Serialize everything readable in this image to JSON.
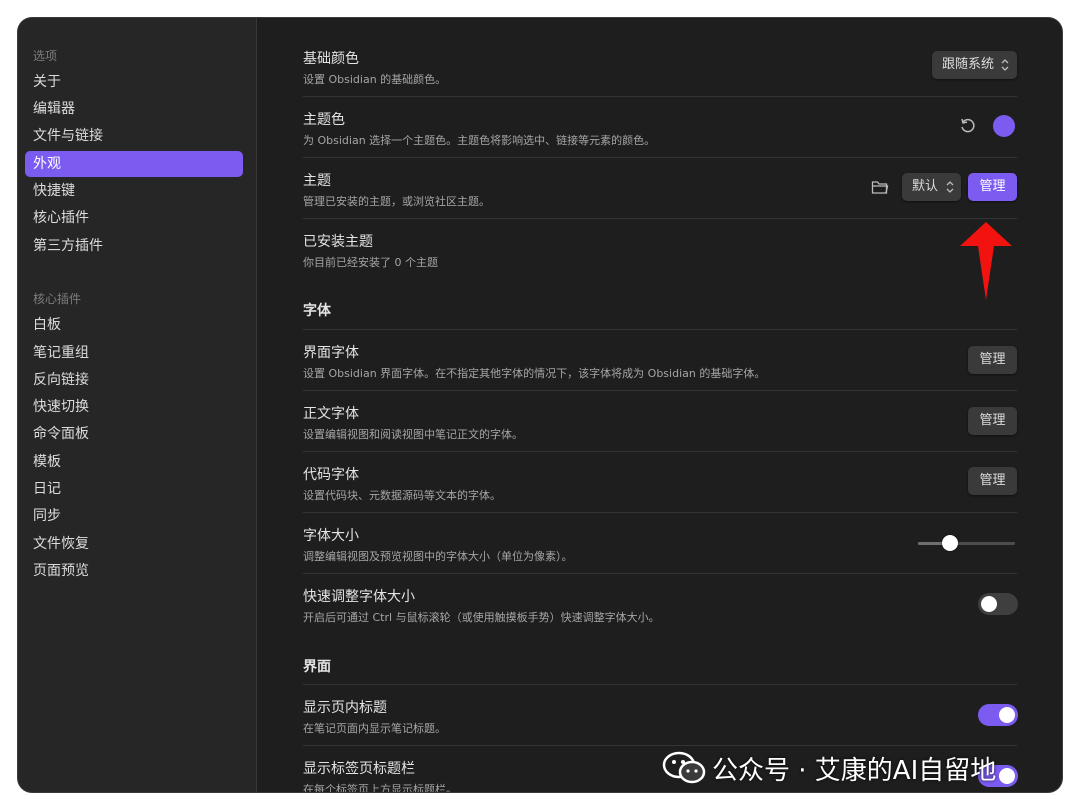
{
  "colors": {
    "accent": "#7b5bf0",
    "background": "#1e1e1e",
    "sidebar": "#262626"
  },
  "sidebar": {
    "sections": [
      {
        "title": "选项",
        "items": [
          "关于",
          "编辑器",
          "文件与链接",
          "外观",
          "快捷键",
          "核心插件",
          "第三方插件"
        ],
        "active_index": 3
      },
      {
        "title": "核心插件",
        "items": [
          "白板",
          "笔记重组",
          "反向链接",
          "快速切换",
          "命令面板",
          "模板",
          "日记",
          "同步",
          "文件恢复",
          "页面预览"
        ]
      }
    ]
  },
  "settings": {
    "base_color": {
      "title": "基础颜色",
      "desc": "设置 Obsidian 的基础颜色。",
      "value": "跟随系统"
    },
    "accent_color": {
      "title": "主题色",
      "desc": "为 Obsidian 选择一个主题色。主题色将影响选中、链接等元素的颜色。",
      "value": "#7b5bf0"
    },
    "theme": {
      "title": "主题",
      "desc": "管理已安装的主题，或浏览社区主题。",
      "value": "默认",
      "manage_label": "管理"
    },
    "installed_themes": {
      "title": "已安装主题",
      "desc": "你目前已经安装了 0 个主题"
    },
    "font_heading": "字体",
    "interface_font": {
      "title": "界面字体",
      "desc": "设置 Obsidian 界面字体。在不指定其他字体的情况下，该字体将成为 Obsidian 的基础字体。",
      "button": "管理"
    },
    "text_font": {
      "title": "正文字体",
      "desc": "设置编辑视图和阅读视图中笔记正文的字体。",
      "button": "管理"
    },
    "code_font": {
      "title": "代码字体",
      "desc": "设置代码块、元数据源码等文本的字体。",
      "button": "管理"
    },
    "font_size": {
      "title": "字体大小",
      "desc": "调整编辑视图及预览视图中的字体大小（单位为像素）。",
      "level": 0.33
    },
    "quick_font_size": {
      "title": "快速调整字体大小",
      "desc": "开启后可通过 Ctrl 与鼠标滚轮（或使用触摸板手势）快速调整字体大小。",
      "enabled": false
    },
    "interface_heading": "界面",
    "inline_title": {
      "title": "显示页内标题",
      "desc": "在笔记页面内显示笔记标题。",
      "enabled": true
    },
    "tab_title_bar": {
      "title": "显示标签页标题栏",
      "desc": "在每个标签页上方显示标题栏。",
      "enabled": true
    }
  },
  "watermark": {
    "text": "公众号 · 艾康的AI自留地"
  }
}
